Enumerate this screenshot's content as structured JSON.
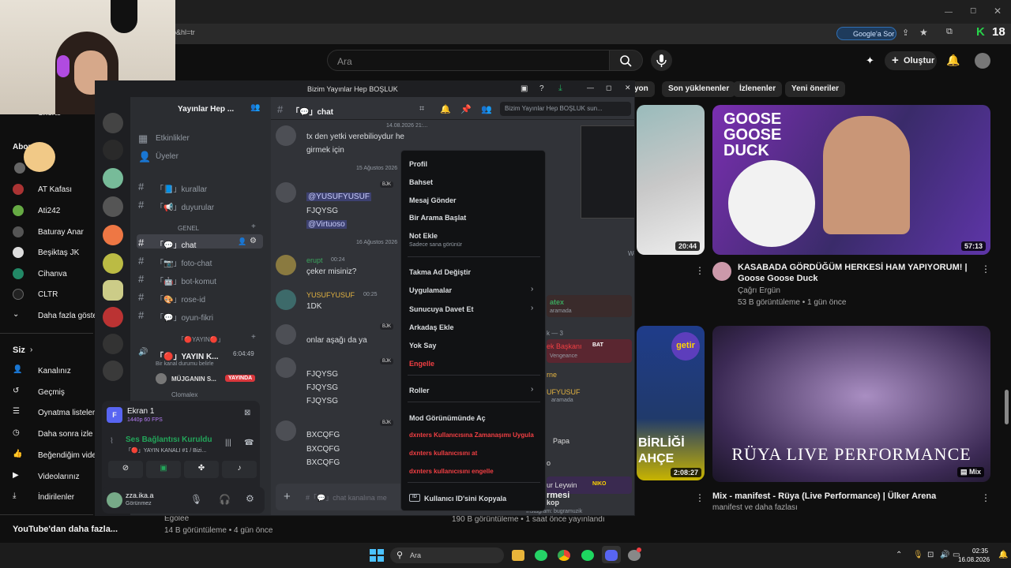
{
  "browser": {
    "url": "p&hl=tr",
    "google_ask": "Google'a Sor",
    "ext_k": "K",
    "ext_count": "18"
  },
  "youtube": {
    "search_placeholder": "Ara",
    "create_label": "Oluştur",
    "chips": [
      "yon",
      "Son yüklenenler",
      "İzlenenler",
      "Yeni öneriler"
    ],
    "sidebar": {
      "shorts": "Shorts",
      "subscriptions": "Abon",
      "channels": [
        "AT Kafası",
        "Ati242",
        "Baturay Anar",
        "Beşiktaş JK",
        "Cihanva",
        "CLTR"
      ],
      "more": "Daha fazla göste",
      "you": "Siz",
      "you_items": [
        "Kanalınız",
        "Geçmiş",
        "Oynatma listeleri",
        "Daha sonra izle",
        "Beğendiğim vide",
        "Videolarınız",
        "İndirilenler"
      ],
      "more_from": "YouTube'dan daha fazla..."
    },
    "videos": [
      {
        "duration": "20:44"
      },
      {
        "title": "KASABADA GÖRDÜĞÜM HERKESİ HAM YAPIYORUM! | Goose Goose Duck",
        "channel": "Çağrı Ergün",
        "meta": "53 B görüntüleme • 1 gün önce",
        "duration": "57:13",
        "thumb_text": "GOOSE GOOSE DUCK"
      },
      {
        "duration": "2:08:27",
        "thumb_text1": "getir",
        "thumb_text2": "BİRLİĞİ",
        "thumb_text3": "AHÇE"
      },
      {
        "title": "Mix - manifest - Rüya (Live Performance) | Ülker Arena",
        "channel": "manifest ve daha fazlası",
        "badge": "Mix",
        "thumb_text": "RÜYA LIVE PERFORMANCE"
      }
    ],
    "below_left": {
      "channel": "Egolee",
      "meta": "14 B görüntüleme • 4 gün önce",
      "meta2": "190 B görüntüleme • 1 saat önce yayınlandı",
      "title_frag": "rmesi"
    }
  },
  "discord": {
    "window_title": "Bizim Yayınlar Hep BOŞLUK",
    "server_name": "Yayınlar Hep ...",
    "channel_header": "「💬」chat",
    "search_placeholder": "Bizim Yayınlar Hep BOŞLUK sun...",
    "events": "Etkinlikler",
    "members": "Üyeler",
    "channels_top": [
      "「📘」kurallar",
      "「📢」duyurular"
    ],
    "category_general": "GENEL",
    "channels_general": [
      "「💬」chat",
      "「📷」foto-chat",
      "「🤖」bot-komut",
      "「🎨」rose-id",
      "「💬」oyun-fikri"
    ],
    "category_stream": "「🔴YAYIN🔴」",
    "voice_channel": "「🔴」YAYIN K...",
    "voice_time": "6:04:49",
    "voice_status": "Bir kanal durumu belirle",
    "voice_user": "MÜJGANIN S...",
    "live_badge": "YAYINDA",
    "voice_user2": "Clomalex",
    "screen_title": "Ekran 1",
    "screen_sub": "1440p 60 FPS",
    "connection": "Ses Bağlantısı Kuruldu",
    "connection_sub": "「🔴」YAYIN KANALI #1 / Bizi...",
    "user_name": "zza.ika.a",
    "user_status": "Görünmez",
    "input_placeholder": "#「💬」chat kanalına me",
    "messages": {
      "m1_time": "14.08.2026 21:...",
      "m1_line1": "tx den yetki verebilioydur he",
      "m1_line2": "girmek için",
      "date1": "15 Ağustos 2026",
      "m2_mention1": "@YUSUFYUSUF",
      "m2_text": "FJQYSG",
      "m2_mention2": "@Virtuoso",
      "date2": "16 Ağustos 2026",
      "erupt_name": "erupt",
      "erupt_time": "00:24",
      "erupt_text": "çeker misiniz?",
      "yusuf_name": "YUSUFYUSUF",
      "yusuf_time": "00:25",
      "yusuf_text": "1DK",
      "m5_text": "onlar aşağı da ya",
      "m6_lines": [
        "FJQYSG",
        "FJQYSG",
        "FJQYSG"
      ],
      "m7_lines": [
        "BXCQFG",
        "BXCQFG",
        "BXCQFG"
      ],
      "tag": "BJK"
    },
    "member_list": {
      "one": "1",
      "weeknd": "Weeknd",
      "atex": "atex",
      "in_search": "aramada",
      "three": "k — 3",
      "president": "ek Başkanı",
      "bat": "BAT",
      "vengeance": "Vengeance",
      "rne": "rne",
      "yusuf": "UFYUSUF",
      "papa": "Papa",
      "o": "o",
      "leywin": "ur Leywin",
      "niko": "NIKO",
      "kop": "kop",
      "insta": "Instagram: bugramuzik"
    }
  },
  "context_menu": {
    "items": [
      "Profil",
      "Bahset",
      "Mesaj Gönder",
      "Bir Arama Başlat",
      "Not Ekle",
      "Takma Ad Değiştir",
      "Uygulamalar",
      "Sunucuya Davet Et",
      "Arkadaş Ekle",
      "Yok Say",
      "Engelle",
      "Roller",
      "Mod Görünümünde Aç",
      "dxnters Kullanıcısına Zamanaşımı Uygula",
      "dxnters kullanıcısını at",
      "dxnters kullanıcısını engelle",
      "Kullanıcı ID'sini Kopyala"
    ],
    "note_sub": "Sadece sana görünür"
  },
  "taskbar": {
    "search": "Ara",
    "time": "02:35",
    "date": "16.08.2026"
  },
  "colors": {
    "discord_bg": "#313338",
    "discord_red": "#f23f43",
    "mention": "#c9cdfb",
    "live_red": "#da373c"
  }
}
